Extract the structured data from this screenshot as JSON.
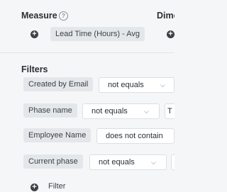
{
  "measure": {
    "title": "Measure",
    "help_icon": "help-circle-icon",
    "add_icon": "plus-circle-icon",
    "item_label": "Lead Time (Hours) - Avg"
  },
  "dimensions": {
    "title": "Dime",
    "add_icon": "plus-circle-icon"
  },
  "filters": {
    "title": "Filters",
    "rows": [
      {
        "field": "Created by Email",
        "operator": "not equals",
        "chevron": "⌵"
      },
      {
        "field": "Phase name",
        "operator": "not equals",
        "chevron": "⌵",
        "value_stub": "T"
      },
      {
        "field": "Employee Name",
        "operator": "does not contain"
      },
      {
        "field": "Current phase",
        "operator": "not equals",
        "chevron": "⌵",
        "value_stub": ""
      }
    ],
    "add_label": "Filter",
    "add_icon": "plus-circle-icon"
  }
}
